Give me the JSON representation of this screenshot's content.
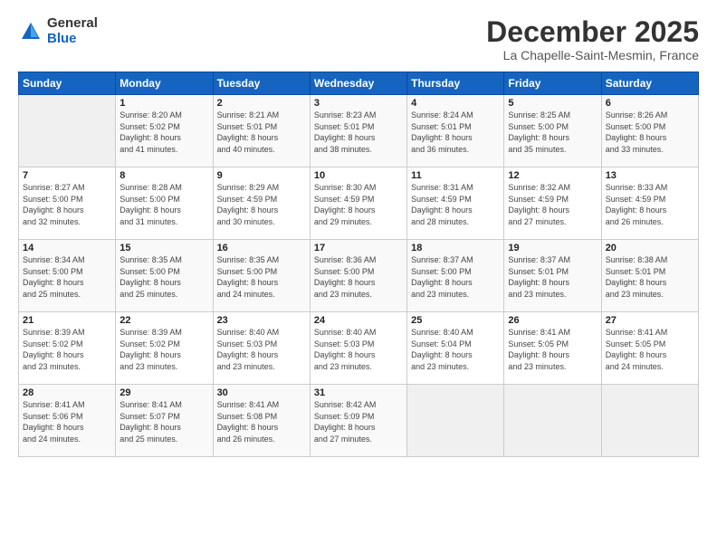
{
  "logo": {
    "general": "General",
    "blue": "Blue"
  },
  "header": {
    "month": "December 2025",
    "location": "La Chapelle-Saint-Mesmin, France"
  },
  "days_of_week": [
    "Sunday",
    "Monday",
    "Tuesday",
    "Wednesday",
    "Thursday",
    "Friday",
    "Saturday"
  ],
  "weeks": [
    [
      {
        "num": "",
        "info": ""
      },
      {
        "num": "1",
        "info": "Sunrise: 8:20 AM\nSunset: 5:02 PM\nDaylight: 8 hours\nand 41 minutes."
      },
      {
        "num": "2",
        "info": "Sunrise: 8:21 AM\nSunset: 5:01 PM\nDaylight: 8 hours\nand 40 minutes."
      },
      {
        "num": "3",
        "info": "Sunrise: 8:23 AM\nSunset: 5:01 PM\nDaylight: 8 hours\nand 38 minutes."
      },
      {
        "num": "4",
        "info": "Sunrise: 8:24 AM\nSunset: 5:01 PM\nDaylight: 8 hours\nand 36 minutes."
      },
      {
        "num": "5",
        "info": "Sunrise: 8:25 AM\nSunset: 5:00 PM\nDaylight: 8 hours\nand 35 minutes."
      },
      {
        "num": "6",
        "info": "Sunrise: 8:26 AM\nSunset: 5:00 PM\nDaylight: 8 hours\nand 33 minutes."
      }
    ],
    [
      {
        "num": "7",
        "info": "Sunrise: 8:27 AM\nSunset: 5:00 PM\nDaylight: 8 hours\nand 32 minutes."
      },
      {
        "num": "8",
        "info": "Sunrise: 8:28 AM\nSunset: 5:00 PM\nDaylight: 8 hours\nand 31 minutes."
      },
      {
        "num": "9",
        "info": "Sunrise: 8:29 AM\nSunset: 4:59 PM\nDaylight: 8 hours\nand 30 minutes."
      },
      {
        "num": "10",
        "info": "Sunrise: 8:30 AM\nSunset: 4:59 PM\nDaylight: 8 hours\nand 29 minutes."
      },
      {
        "num": "11",
        "info": "Sunrise: 8:31 AM\nSunset: 4:59 PM\nDaylight: 8 hours\nand 28 minutes."
      },
      {
        "num": "12",
        "info": "Sunrise: 8:32 AM\nSunset: 4:59 PM\nDaylight: 8 hours\nand 27 minutes."
      },
      {
        "num": "13",
        "info": "Sunrise: 8:33 AM\nSunset: 4:59 PM\nDaylight: 8 hours\nand 26 minutes."
      }
    ],
    [
      {
        "num": "14",
        "info": "Sunrise: 8:34 AM\nSunset: 5:00 PM\nDaylight: 8 hours\nand 25 minutes."
      },
      {
        "num": "15",
        "info": "Sunrise: 8:35 AM\nSunset: 5:00 PM\nDaylight: 8 hours\nand 25 minutes."
      },
      {
        "num": "16",
        "info": "Sunrise: 8:35 AM\nSunset: 5:00 PM\nDaylight: 8 hours\nand 24 minutes."
      },
      {
        "num": "17",
        "info": "Sunrise: 8:36 AM\nSunset: 5:00 PM\nDaylight: 8 hours\nand 23 minutes."
      },
      {
        "num": "18",
        "info": "Sunrise: 8:37 AM\nSunset: 5:00 PM\nDaylight: 8 hours\nand 23 minutes."
      },
      {
        "num": "19",
        "info": "Sunrise: 8:37 AM\nSunset: 5:01 PM\nDaylight: 8 hours\nand 23 minutes."
      },
      {
        "num": "20",
        "info": "Sunrise: 8:38 AM\nSunset: 5:01 PM\nDaylight: 8 hours\nand 23 minutes."
      }
    ],
    [
      {
        "num": "21",
        "info": "Sunrise: 8:39 AM\nSunset: 5:02 PM\nDaylight: 8 hours\nand 23 minutes."
      },
      {
        "num": "22",
        "info": "Sunrise: 8:39 AM\nSunset: 5:02 PM\nDaylight: 8 hours\nand 23 minutes."
      },
      {
        "num": "23",
        "info": "Sunrise: 8:40 AM\nSunset: 5:03 PM\nDaylight: 8 hours\nand 23 minutes."
      },
      {
        "num": "24",
        "info": "Sunrise: 8:40 AM\nSunset: 5:03 PM\nDaylight: 8 hours\nand 23 minutes."
      },
      {
        "num": "25",
        "info": "Sunrise: 8:40 AM\nSunset: 5:04 PM\nDaylight: 8 hours\nand 23 minutes."
      },
      {
        "num": "26",
        "info": "Sunrise: 8:41 AM\nSunset: 5:05 PM\nDaylight: 8 hours\nand 23 minutes."
      },
      {
        "num": "27",
        "info": "Sunrise: 8:41 AM\nSunset: 5:05 PM\nDaylight: 8 hours\nand 24 minutes."
      }
    ],
    [
      {
        "num": "28",
        "info": "Sunrise: 8:41 AM\nSunset: 5:06 PM\nDaylight: 8 hours\nand 24 minutes."
      },
      {
        "num": "29",
        "info": "Sunrise: 8:41 AM\nSunset: 5:07 PM\nDaylight: 8 hours\nand 25 minutes."
      },
      {
        "num": "30",
        "info": "Sunrise: 8:41 AM\nSunset: 5:08 PM\nDaylight: 8 hours\nand 26 minutes."
      },
      {
        "num": "31",
        "info": "Sunrise: 8:42 AM\nSunset: 5:09 PM\nDaylight: 8 hours\nand 27 minutes."
      },
      {
        "num": "",
        "info": ""
      },
      {
        "num": "",
        "info": ""
      },
      {
        "num": "",
        "info": ""
      }
    ]
  ]
}
